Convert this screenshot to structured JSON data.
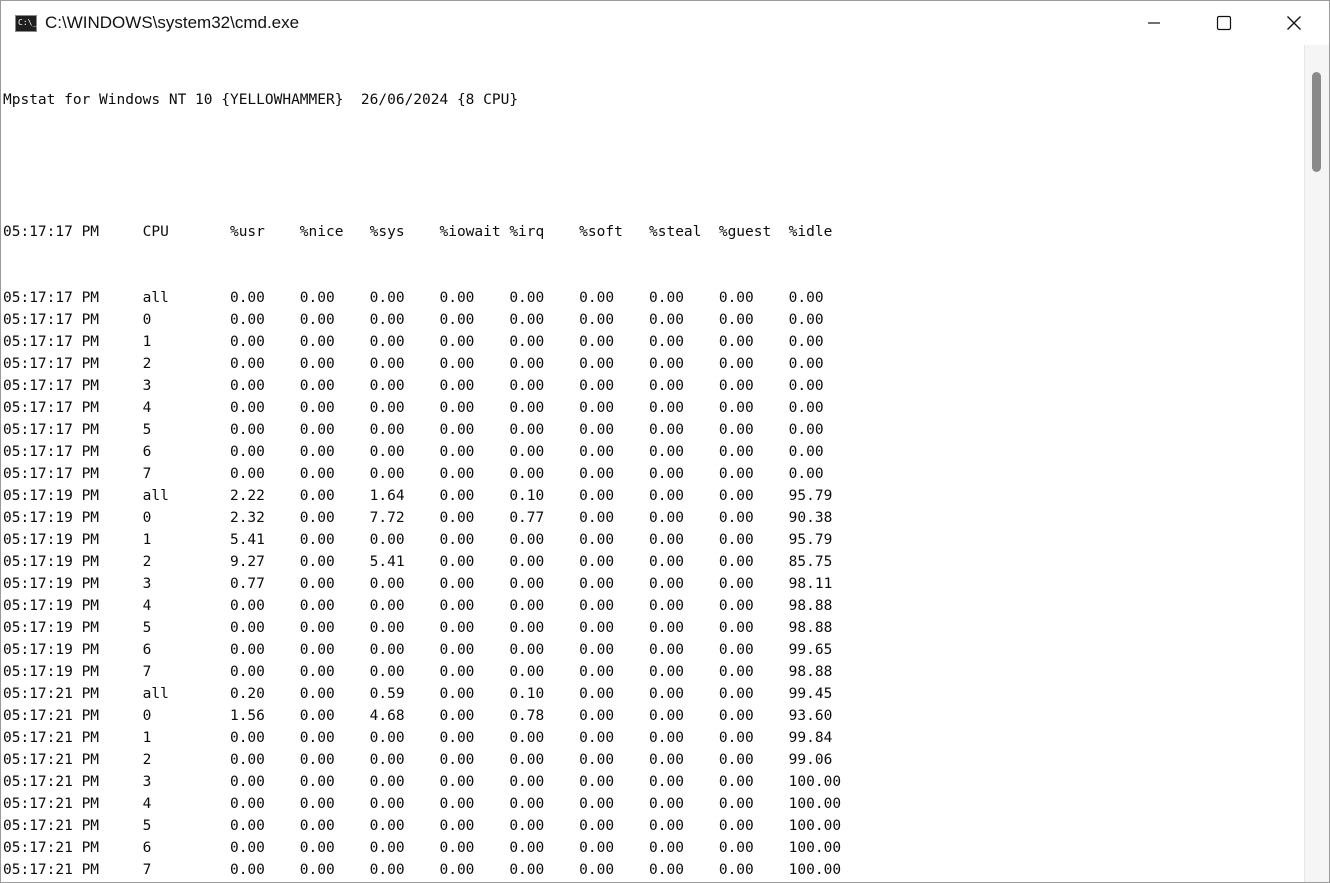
{
  "window": {
    "title": "C:\\WINDOWS\\system32\\cmd.exe",
    "icons": [
      "cmd-icon",
      "minimize-icon",
      "maximize-icon",
      "close-icon"
    ]
  },
  "terminal": {
    "header": "Mpstat for Windows NT 10 {YELLOWHAMMER}  26/06/2024 {8 CPU}",
    "columns": [
      "CPU",
      "%usr",
      "%nice",
      "%sys",
      "%iowait",
      "%irq",
      "%soft",
      "%steal",
      "%guest",
      "%idle"
    ],
    "header_time": "05:17:17 PM",
    "rows": [
      [
        "05:17:17 PM",
        "all",
        "0.00",
        "0.00",
        "0.00",
        "0.00",
        "0.00",
        "0.00",
        "0.00",
        "0.00",
        "0.00"
      ],
      [
        "05:17:17 PM",
        "0",
        "0.00",
        "0.00",
        "0.00",
        "0.00",
        "0.00",
        "0.00",
        "0.00",
        "0.00",
        "0.00"
      ],
      [
        "05:17:17 PM",
        "1",
        "0.00",
        "0.00",
        "0.00",
        "0.00",
        "0.00",
        "0.00",
        "0.00",
        "0.00",
        "0.00"
      ],
      [
        "05:17:17 PM",
        "2",
        "0.00",
        "0.00",
        "0.00",
        "0.00",
        "0.00",
        "0.00",
        "0.00",
        "0.00",
        "0.00"
      ],
      [
        "05:17:17 PM",
        "3",
        "0.00",
        "0.00",
        "0.00",
        "0.00",
        "0.00",
        "0.00",
        "0.00",
        "0.00",
        "0.00"
      ],
      [
        "05:17:17 PM",
        "4",
        "0.00",
        "0.00",
        "0.00",
        "0.00",
        "0.00",
        "0.00",
        "0.00",
        "0.00",
        "0.00"
      ],
      [
        "05:17:17 PM",
        "5",
        "0.00",
        "0.00",
        "0.00",
        "0.00",
        "0.00",
        "0.00",
        "0.00",
        "0.00",
        "0.00"
      ],
      [
        "05:17:17 PM",
        "6",
        "0.00",
        "0.00",
        "0.00",
        "0.00",
        "0.00",
        "0.00",
        "0.00",
        "0.00",
        "0.00"
      ],
      [
        "05:17:17 PM",
        "7",
        "0.00",
        "0.00",
        "0.00",
        "0.00",
        "0.00",
        "0.00",
        "0.00",
        "0.00",
        "0.00"
      ],
      [
        "05:17:19 PM",
        "all",
        "2.22",
        "0.00",
        "1.64",
        "0.00",
        "0.10",
        "0.00",
        "0.00",
        "0.00",
        "95.79"
      ],
      [
        "05:17:19 PM",
        "0",
        "2.32",
        "0.00",
        "7.72",
        "0.00",
        "0.77",
        "0.00",
        "0.00",
        "0.00",
        "90.38"
      ],
      [
        "05:17:19 PM",
        "1",
        "5.41",
        "0.00",
        "0.00",
        "0.00",
        "0.00",
        "0.00",
        "0.00",
        "0.00",
        "95.79"
      ],
      [
        "05:17:19 PM",
        "2",
        "9.27",
        "0.00",
        "5.41",
        "0.00",
        "0.00",
        "0.00",
        "0.00",
        "0.00",
        "85.75"
      ],
      [
        "05:17:19 PM",
        "3",
        "0.77",
        "0.00",
        "0.00",
        "0.00",
        "0.00",
        "0.00",
        "0.00",
        "0.00",
        "98.11"
      ],
      [
        "05:17:19 PM",
        "4",
        "0.00",
        "0.00",
        "0.00",
        "0.00",
        "0.00",
        "0.00",
        "0.00",
        "0.00",
        "98.88"
      ],
      [
        "05:17:19 PM",
        "5",
        "0.00",
        "0.00",
        "0.00",
        "0.00",
        "0.00",
        "0.00",
        "0.00",
        "0.00",
        "98.88"
      ],
      [
        "05:17:19 PM",
        "6",
        "0.00",
        "0.00",
        "0.00",
        "0.00",
        "0.00",
        "0.00",
        "0.00",
        "0.00",
        "99.65"
      ],
      [
        "05:17:19 PM",
        "7",
        "0.00",
        "0.00",
        "0.00",
        "0.00",
        "0.00",
        "0.00",
        "0.00",
        "0.00",
        "98.88"
      ],
      [
        "05:17:21 PM",
        "all",
        "0.20",
        "0.00",
        "0.59",
        "0.00",
        "0.10",
        "0.00",
        "0.00",
        "0.00",
        "99.45"
      ],
      [
        "05:17:21 PM",
        "0",
        "1.56",
        "0.00",
        "4.68",
        "0.00",
        "0.78",
        "0.00",
        "0.00",
        "0.00",
        "93.60"
      ],
      [
        "05:17:21 PM",
        "1",
        "0.00",
        "0.00",
        "0.00",
        "0.00",
        "0.00",
        "0.00",
        "0.00",
        "0.00",
        "99.84"
      ],
      [
        "05:17:21 PM",
        "2",
        "0.00",
        "0.00",
        "0.00",
        "0.00",
        "0.00",
        "0.00",
        "0.00",
        "0.00",
        "99.06"
      ],
      [
        "05:17:21 PM",
        "3",
        "0.00",
        "0.00",
        "0.00",
        "0.00",
        "0.00",
        "0.00",
        "0.00",
        "0.00",
        "100.00"
      ],
      [
        "05:17:21 PM",
        "4",
        "0.00",
        "0.00",
        "0.00",
        "0.00",
        "0.00",
        "0.00",
        "0.00",
        "0.00",
        "100.00"
      ],
      [
        "05:17:21 PM",
        "5",
        "0.00",
        "0.00",
        "0.00",
        "0.00",
        "0.00",
        "0.00",
        "0.00",
        "0.00",
        "100.00"
      ],
      [
        "05:17:21 PM",
        "6",
        "0.00",
        "0.00",
        "0.00",
        "0.00",
        "0.00",
        "0.00",
        "0.00",
        "0.00",
        "100.00"
      ],
      [
        "05:17:21 PM",
        "7",
        "0.00",
        "0.00",
        "0.00",
        "0.00",
        "0.00",
        "0.00",
        "0.00",
        "0.00",
        "100.00"
      ]
    ]
  }
}
